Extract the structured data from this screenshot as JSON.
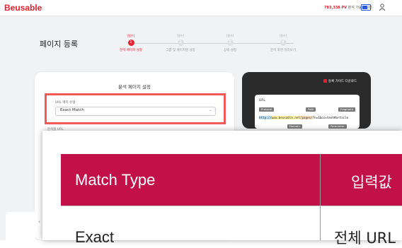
{
  "app": {
    "logo": "Beusable",
    "pv_highlight": "783,338 PV",
    "pv_rest": " 분석 가능합니다."
  },
  "page": {
    "title": "페이지 등록"
  },
  "steps": [
    {
      "top": "[필수]",
      "number": "1",
      "label": "분석 페이지 설정",
      "active": true
    },
    {
      "top": "[필수]",
      "number": "2",
      "label": "그룹 및 페이지명 설정",
      "active": false
    },
    {
      "top": "[필수]",
      "number": "3",
      "label": "상세 설정",
      "active": false
    },
    {
      "top": "[필수]",
      "number": "4",
      "label": "분석 화면 미리보기",
      "active": false
    }
  ],
  "form": {
    "title": "분석 페이지 설정",
    "url_type_label": "URL 매치 유형",
    "url_type_value": "Exact Match",
    "url_label": "분석할 URL"
  },
  "guide": {
    "download_label": "등록 가이드 다운로드",
    "url_title": "URL",
    "tags": {
      "protocol": "Protocol",
      "path": "Path",
      "fragment": "Fragment",
      "domain": "Domain",
      "parameter": "Parameter"
    },
    "url_protocol": "http://",
    "url_domain": "www.beusable.net",
    "url_path": "/pages/",
    "url_rest": "?n=1&cc=text#article"
  },
  "table": {
    "headers": [
      "Match Type",
      "입력값"
    ],
    "first_row": [
      "Exact",
      "전체 URL"
    ]
  },
  "colors": {
    "brand": "#e5202f",
    "table_header": "#c2104a",
    "highlight_border": "#f25a5a"
  },
  "icons": [
    "user-icon",
    "battery-icon",
    "pdf-icon",
    "chevron-down-icon",
    "back-arrow-icon"
  ]
}
